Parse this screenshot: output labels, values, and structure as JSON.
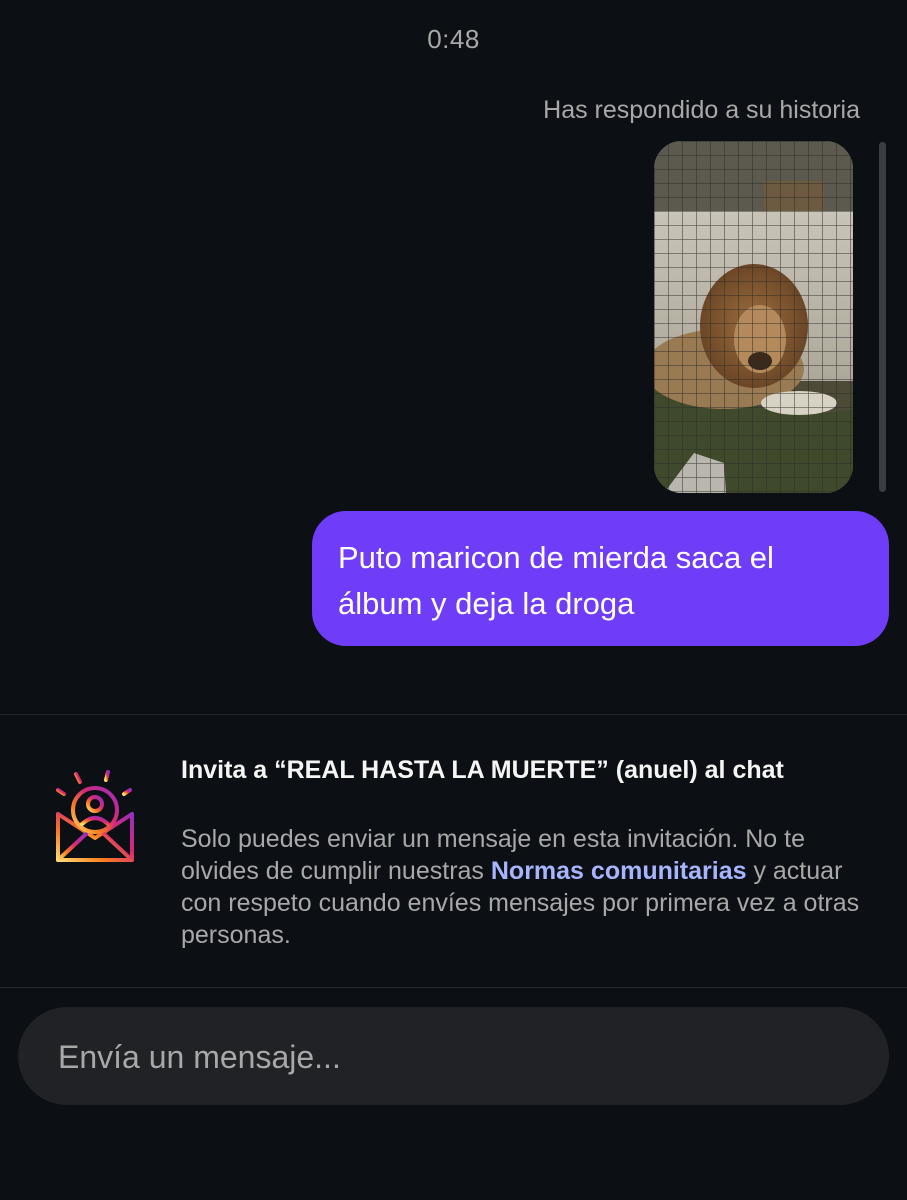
{
  "thread": {
    "timestamp": "0:48",
    "story_reply_label": "Has respondido a su historia",
    "sent_message": "Puto maricon de mierda saca el álbum y deja la droga"
  },
  "invite": {
    "icon": "envelope-person-icon",
    "title": "Invita a “REAL HASTA LA MUERTE” (anuel) al chat",
    "body_before_link": "Solo puedes enviar un mensaje en esta invitación. No te olvides de cumplir nuestras ",
    "link_label": "Normas comunitarias",
    "body_after_link": " y actuar con respeto cuando envíes mensajes por primera vez a otras personas."
  },
  "composer": {
    "placeholder": "Envía un mensaje..."
  },
  "colors": {
    "background": "#0c1014",
    "bubble": "#6f3df7",
    "secondary_text": "#a8a8a8",
    "link": "#a7b5ff",
    "composer": "#202226"
  }
}
